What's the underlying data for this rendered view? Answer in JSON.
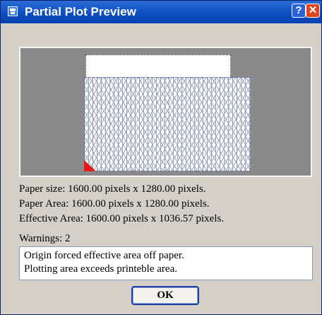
{
  "window": {
    "title": "Partial Plot Preview",
    "help_glyph": "?",
    "close_glyph": "✕",
    "icon": "app-window-icon"
  },
  "info": {
    "paper_size": "Paper size:  1600.00 pixels x 1280.00 pixels.",
    "paper_area": "Paper Area:  1600.00 pixels x 1280.00 pixels.",
    "effective_area": "Effective Area:  1600.00 pixels x 1036.57 pixels."
  },
  "warnings": {
    "label": "Warnings:  2",
    "items": [
      "Origin forced effective area off paper.",
      "Plotting area exceeds printeble area."
    ]
  },
  "buttons": {
    "ok": "OK"
  },
  "colors": {
    "titlebar": "#0b4cc0",
    "preview_bg": "#8a8a8a",
    "origin_marker": "#e8191b",
    "close_button": "#e0441c"
  }
}
